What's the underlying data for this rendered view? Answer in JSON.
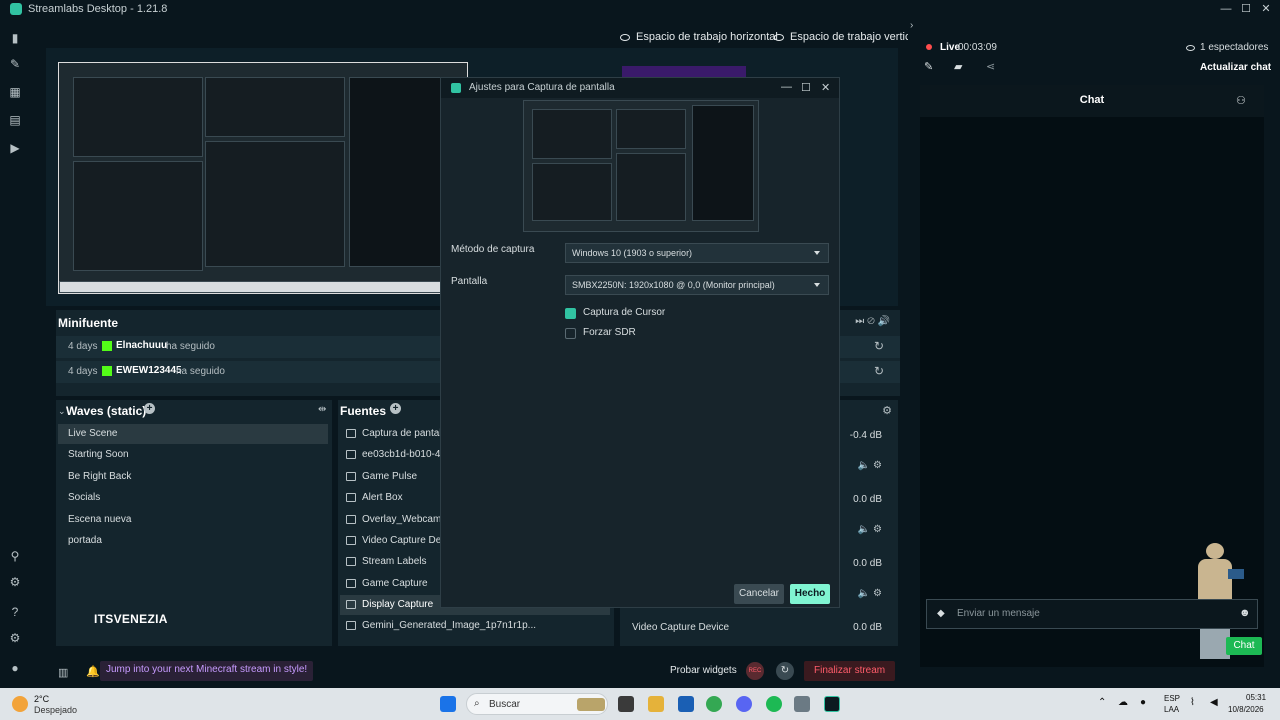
{
  "window": {
    "title": "Streamlabs Desktop - 1.21.8"
  },
  "layout_buttons": {
    "horizontal": "Espacio de trabajo horizontal",
    "vertical": "Espacio de trabajo vertical"
  },
  "status": {
    "live_label": "Live",
    "timer": "00:03:09",
    "viewers": "1 espectadores",
    "refresh_chat": "Actualizar chat"
  },
  "minifuente": {
    "title": "Minifuente",
    "rows": [
      {
        "days": "4 days",
        "user": "Elnachuuu",
        "action": "ha seguido"
      },
      {
        "days": "4 days",
        "user": "EWEW123445",
        "action": "ha seguido"
      }
    ]
  },
  "scenes": {
    "title": "Waves (static)",
    "items": [
      "Live Scene",
      "Starting Soon",
      "Be Right Back",
      "Socials",
      "Escena nueva",
      "portada"
    ],
    "brand": "ITSVENEZIA"
  },
  "sources": {
    "title": "Fuentes",
    "items": [
      {
        "label": "Captura de pantalla",
        "icon": "image-icon"
      },
      {
        "label": "ee03cb1d-b010-409",
        "icon": "image-icon"
      },
      {
        "label": "Game Pulse",
        "icon": "image-icon"
      },
      {
        "label": "Alert Box",
        "icon": "image-icon"
      },
      {
        "label": "Overlay_Webcam_1",
        "icon": "image-icon"
      },
      {
        "label": "Video Capture Devic",
        "icon": "camera-icon"
      },
      {
        "label": "Stream Labels",
        "icon": "folder-icon"
      },
      {
        "label": "Game Capture",
        "icon": "gamepad-icon"
      },
      {
        "label": "Display Capture",
        "icon": "monitor-icon"
      },
      {
        "label": "Gemini_Generated_Image_1p7n1r1p...",
        "icon": "image-icon"
      }
    ]
  },
  "mixer": {
    "rows": [
      {
        "label": "",
        "db": "-0.4 dB"
      },
      {
        "label": "",
        "db": "0.0 dB"
      },
      {
        "label": "",
        "db": "0.0 dB"
      },
      {
        "label": "Video Capture Device",
        "db": "0.0 dB"
      }
    ]
  },
  "bottombar": {
    "promo": "Jump into your next Minecraft stream in style!",
    "probar": "Probar widgets",
    "rec": "REC",
    "end_stream": "Finalizar stream"
  },
  "dialog": {
    "title": "Ajustes para Captura de pantalla",
    "method_label": "Método de captura",
    "method_value": "Windows 10 (1903 o superior)",
    "screen_label": "Pantalla",
    "screen_value": "SMBX2250N: 1920x1080 @ 0,0 (Monitor principal)",
    "cursor_label": "Captura de Cursor",
    "sdr_label": "Forzar SDR",
    "cancel": "Cancelar",
    "ok": "Hecho"
  },
  "chat": {
    "title": "Chat",
    "placeholder": "Enviar un mensaje",
    "send": "Chat"
  },
  "taskbar": {
    "weather_temp": "2°C",
    "weather_desc": "Despejado",
    "search": "Buscar",
    "lang1": "ESP",
    "lang2": "LAA",
    "time": "05:31",
    "date": "10/8/2026"
  },
  "colors": {
    "accent": "#31c3a2",
    "live_red": "#ff4d4d",
    "end_stream": "#ff5c6a",
    "promo": "#c79bff"
  }
}
